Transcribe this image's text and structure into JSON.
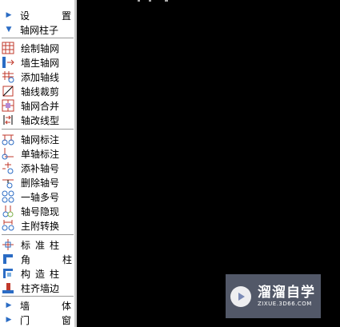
{
  "menu": {
    "settings": "设　置",
    "axis_group": "轴网柱子",
    "items": [
      "绘制轴网",
      "墙生轴网",
      "添加轴线",
      "轴线裁剪",
      "轴网合并",
      "轴改线型",
      "轴网标注",
      "单轴标注",
      "添补轴号",
      "删除轴号",
      "一轴多号",
      "轴号隐现",
      "主附转换",
      "标准柱",
      "角　柱",
      "构造柱",
      "柱齐墙边"
    ],
    "wall": "墙　体",
    "door": "门　窗"
  },
  "watermark": {
    "title": "溜溜自学",
    "url": "ZIXUE.3D66.COM"
  }
}
